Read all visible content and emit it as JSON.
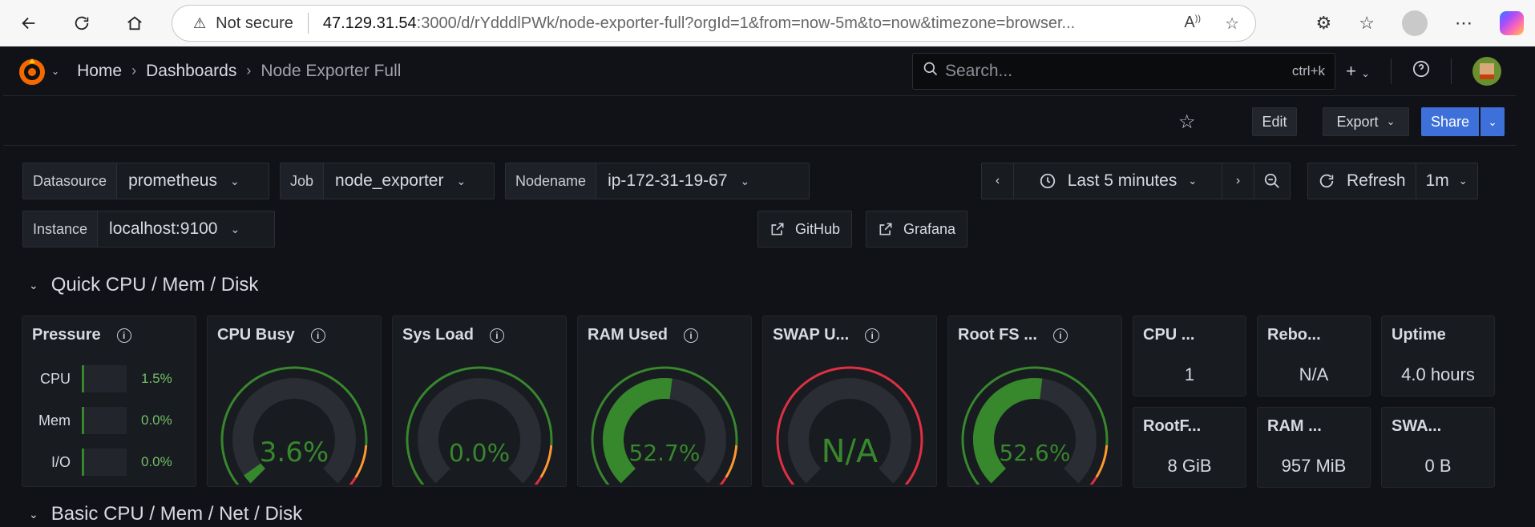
{
  "browser": {
    "security_label": "Not secure",
    "url_host": "47.129.31.54",
    "url_path": ":3000/d/rYdddlPWk/node-exporter-full?orgId=1&from=now-5m&to=now&timezone=browser..."
  },
  "breadcrumb": [
    "Home",
    "Dashboards",
    "Node Exporter Full"
  ],
  "search": {
    "placeholder": "Search...",
    "shortcut": "ctrl+k"
  },
  "toolbar": {
    "edit_label": "Edit",
    "export_label": "Export",
    "share_label": "Share"
  },
  "variables": {
    "datasource": {
      "label": "Datasource",
      "value": "prometheus"
    },
    "job": {
      "label": "Job",
      "value": "node_exporter"
    },
    "nodename": {
      "label": "Nodename",
      "value": "ip-172-31-19-67"
    },
    "instance": {
      "label": "Instance",
      "value": "localhost:9100"
    }
  },
  "links": {
    "github": "GitHub",
    "grafana": "Grafana"
  },
  "time": {
    "range": "Last 5 minutes",
    "refresh_label": "Refresh",
    "interval": "1m"
  },
  "rows": {
    "quick": "Quick CPU / Mem / Disk",
    "basic": "Basic CPU / Mem / Net / Disk"
  },
  "panels": {
    "pressure": {
      "title": "Pressure",
      "items": [
        {
          "label": "CPU",
          "value": "1.5%"
        },
        {
          "label": "Mem",
          "value": "0.0%"
        },
        {
          "label": "I/O",
          "value": "0.0%"
        }
      ]
    },
    "cpu_busy": {
      "title": "CPU Busy",
      "value": "3.6%",
      "percent": 3.6
    },
    "sys_load": {
      "title": "Sys Load",
      "value": "0.0%",
      "percent": 0
    },
    "ram_used": {
      "title": "RAM Used",
      "value": "52.7%",
      "percent": 52.7
    },
    "swap_used": {
      "title": "SWAP U...",
      "value": "N/A",
      "percent": 0
    },
    "root_fs": {
      "title": "Root FS ...",
      "value": "52.6%",
      "percent": 52.6
    },
    "cpu_cores": {
      "title": "CPU ...",
      "value": "1"
    },
    "reboot": {
      "title": "Rebo...",
      "value": "N/A"
    },
    "uptime": {
      "title": "Uptime",
      "value": "4.0 hours"
    },
    "rootfs_total": {
      "title": "RootF...",
      "value": "8 GiB"
    },
    "ram_total": {
      "title": "RAM ...",
      "value": "957 MiB"
    },
    "swap_total": {
      "title": "SWA...",
      "value": "0 B"
    }
  },
  "colors": {
    "green": "#37872d",
    "value_green": "#73bf69",
    "share_blue": "#3d71d9",
    "red": "#e02f44",
    "orange": "#ff9830"
  }
}
